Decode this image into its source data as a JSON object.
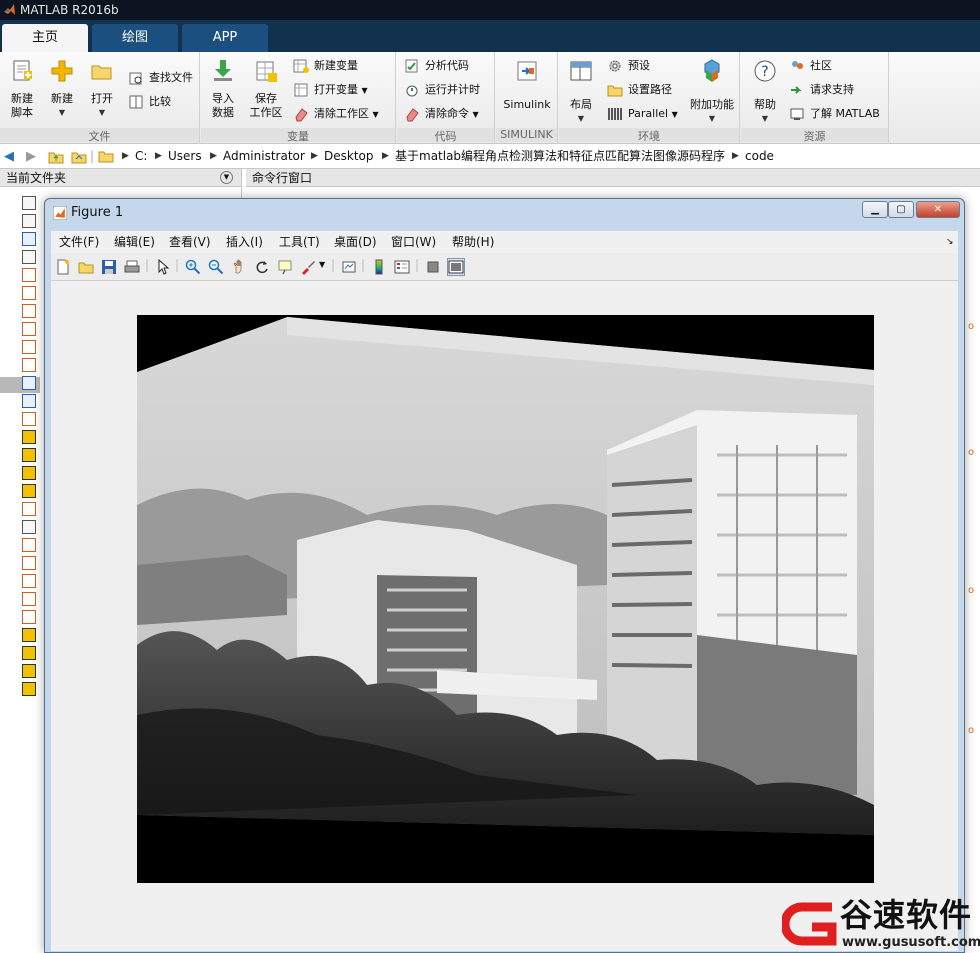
{
  "app": {
    "title": "MATLAB R2016b"
  },
  "tabs": [
    {
      "label": "主页"
    },
    {
      "label": "绘图"
    },
    {
      "label": "APP"
    }
  ],
  "ribbon": {
    "file": {
      "label": "文件",
      "new_script": "新建\n脚本",
      "new": "新建",
      "open": "打开",
      "find_files": "查找文件",
      "compare": "比较"
    },
    "variable": {
      "label": "变量",
      "import": "导入\n数据",
      "save": "保存\n工作区",
      "new_var": "新建变量",
      "open_var": "打开变量",
      "clear_ws": "清除工作区"
    },
    "code": {
      "label": "代码",
      "analyze": "分析代码",
      "run_time": "运行并计时",
      "clear_cmd": "清除命令"
    },
    "simulink": {
      "label": "SIMULINK",
      "simulink": "Simulink"
    },
    "env": {
      "label": "环境",
      "layout": "布局",
      "prefs": "预设",
      "set_path": "设置路径",
      "parallel": "Parallel",
      "addons": "附加功能"
    },
    "resources": {
      "label": "资源",
      "help": "帮助",
      "community": "社区",
      "support": "请求支持",
      "learn": "了解 MATLAB"
    }
  },
  "path": {
    "segments": [
      "C:",
      "Users",
      "Administrator",
      "Desktop",
      "基于matlab编程角点检测算法和特征点匹配算法图像源码程序",
      "code"
    ]
  },
  "panels": {
    "current_folder": "当前文件夹",
    "command_window": "命令行窗口"
  },
  "figure": {
    "title": "Figure 1",
    "menu": [
      "文件(F)",
      "编辑(E)",
      "查看(V)",
      "插入(I)",
      "工具(T)",
      "桌面(D)",
      "窗口(W)",
      "帮助(H)"
    ]
  },
  "watermark": {
    "brand": "谷速软件",
    "url": "www.gususoft.com"
  },
  "colors": {
    "tabbar": "#12314f",
    "tab": "#1b4f80",
    "accent": "#e02020"
  }
}
